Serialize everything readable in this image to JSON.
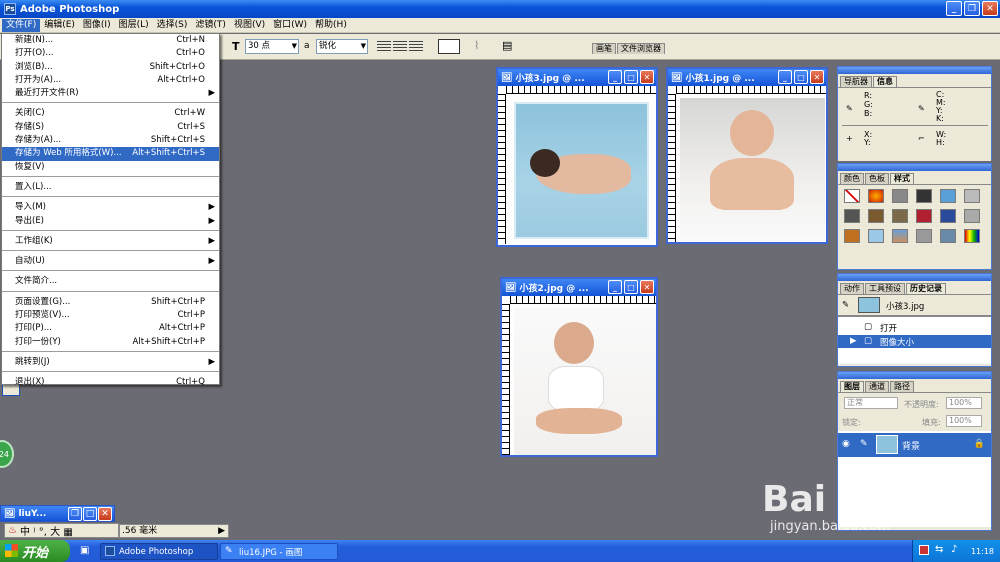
{
  "app": {
    "title": "Adobe Photoshop"
  },
  "menubar": [
    "文件(F)",
    "编辑(E)",
    "图像(I)",
    "图层(L)",
    "选择(S)",
    "滤镜(T)",
    "视图(V)",
    "窗口(W)",
    "帮助(H)"
  ],
  "options": {
    "font_size": "30 点",
    "aa_label": "a",
    "antialias": "锐化",
    "tab_brushes": "画笔",
    "tab_browser": "文件浏览器"
  },
  "file_menu": {
    "items": [
      {
        "label": "新建(N)...",
        "shortcut": "Ctrl+N"
      },
      {
        "label": "打开(O)...",
        "shortcut": "Ctrl+O"
      },
      {
        "label": "浏览(B)...",
        "shortcut": "Shift+Ctrl+O"
      },
      {
        "label": "打开为(A)...",
        "shortcut": "Alt+Ctrl+O"
      },
      {
        "label": "最近打开文件(R)",
        "shortcut": "",
        "submenu": true
      },
      {
        "sep": true
      },
      {
        "label": "关闭(C)",
        "shortcut": "Ctrl+W"
      },
      {
        "label": "存储(S)",
        "shortcut": "Ctrl+S"
      },
      {
        "label": "存储为(A)...",
        "shortcut": "Shift+Ctrl+S"
      },
      {
        "label": "存储为 Web 所用格式(W)...",
        "shortcut": "Alt+Shift+Ctrl+S",
        "highlight": true
      },
      {
        "label": "恢复(V)",
        "shortcut": ""
      },
      {
        "sep": true
      },
      {
        "label": "置入(L)...",
        "shortcut": ""
      },
      {
        "sep": true
      },
      {
        "label": "导入(M)",
        "shortcut": "",
        "submenu": true
      },
      {
        "label": "导出(E)",
        "shortcut": "",
        "submenu": true
      },
      {
        "sep": true
      },
      {
        "label": "工作组(K)",
        "shortcut": "",
        "submenu": true
      },
      {
        "sep": true
      },
      {
        "label": "自动(U)",
        "shortcut": "",
        "submenu": true
      },
      {
        "sep": true
      },
      {
        "label": "文件简介...",
        "shortcut": ""
      },
      {
        "sep": true
      },
      {
        "label": "页面设置(G)...",
        "shortcut": "Shift+Ctrl+P"
      },
      {
        "label": "打印预览(V)...",
        "shortcut": "Ctrl+P"
      },
      {
        "label": "打印(P)...",
        "shortcut": "Alt+Ctrl+P"
      },
      {
        "label": "打印一份(Y)",
        "shortcut": "Alt+Shift+Ctrl+P"
      },
      {
        "sep": true
      },
      {
        "label": "跳转到(J)",
        "shortcut": "",
        "submenu": true
      },
      {
        "sep": true
      },
      {
        "label": "退出(X)",
        "shortcut": "Ctrl+Q"
      }
    ]
  },
  "documents": {
    "doc3": {
      "title": "小孩3.jpg @ ..."
    },
    "doc1": {
      "title": "小孩1.jpg @ ..."
    },
    "doc2": {
      "title": "小孩2.jpg @ ..."
    },
    "minimized": {
      "title": "liuY..."
    }
  },
  "ime": {
    "text": "中 ⁾ °, 大 ▦"
  },
  "status": {
    "measure": ".56 毫米"
  },
  "panels": {
    "navigator": {
      "tab1": "导航器",
      "tab2": "信息",
      "r": "R:",
      "g": "G:",
      "b": "B:",
      "c": "C:",
      "m": "M:",
      "y": "Y:",
      "k": "K:",
      "x": "X:",
      "y2": "Y:",
      "w": "W:",
      "h": "H:"
    },
    "color": {
      "tab1": "颜色",
      "tab2": "色板",
      "tab3": "样式"
    },
    "history": {
      "tab1": "动作",
      "tab2": "工具预设",
      "tab3": "历史记录",
      "snapshot": "小孩3.jpg",
      "items": [
        "打开",
        "图像大小"
      ]
    },
    "layers": {
      "tab1": "图层",
      "tab2": "通道",
      "tab3": "路径",
      "mode": "正常",
      "opacity_label": "不透明度:",
      "opacity": "100%",
      "lock_label": "锁定:",
      "fill_label": "填充:",
      "fill": "100%",
      "layer_name": "背景"
    }
  },
  "taskbar": {
    "start": "开始",
    "tasks": [
      "Adobe Photoshop",
      "liu16.JPG - 画图"
    ],
    "time": "11:18"
  },
  "watermark": {
    "brand": "Bai 经验",
    "url": "jingyan.baidu.com"
  },
  "badge": {
    "number": "24"
  }
}
